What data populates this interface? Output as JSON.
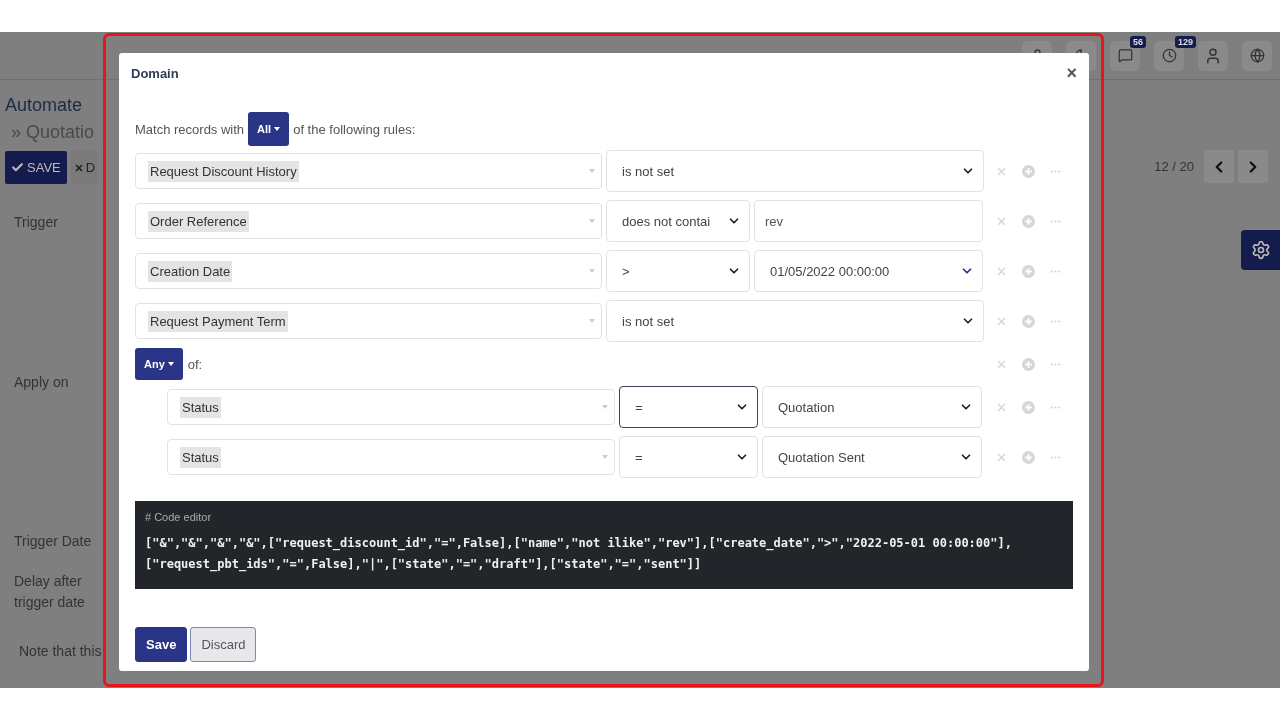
{
  "background": {
    "title": "Automate",
    "breadcrumb": "» Quotatio",
    "save_button": "SAVE",
    "discard_button": "D",
    "topbar_badges": [
      "56",
      "129"
    ],
    "labels": [
      "Trigger",
      "Apply on",
      "Trigger Date",
      "Delay after trigger date",
      "Note that this"
    ],
    "pager": "12 / 20"
  },
  "dialog": {
    "title": "Domain",
    "close": "×",
    "match": {
      "prefix": "Match records with",
      "mode": "All",
      "suffix": "of the following rules:"
    },
    "rules": [
      {
        "kind": "unary",
        "field": "Request Discount History",
        "operator": "is not set",
        "focused": false
      },
      {
        "kind": "input",
        "field": "Order Reference",
        "operator": "does not contai",
        "value": "rev",
        "focused": false
      },
      {
        "kind": "date",
        "field": "Creation Date",
        "operator": ">",
        "value": "01/05/2022 00:00:00",
        "focused": false
      },
      {
        "kind": "unary",
        "field": "Request Payment Term",
        "operator": "is not set",
        "focused": false
      },
      {
        "kind": "group",
        "mode": "Any",
        "suffix": "of:",
        "children": [
          {
            "kind": "select",
            "field": "Status",
            "operator": "=",
            "value": "Quotation",
            "focused": true
          },
          {
            "kind": "select",
            "field": "Status",
            "operator": "=",
            "value": "Quotation Sent",
            "focused": false
          }
        ]
      }
    ],
    "code_editor": {
      "label": "# Code editor",
      "lines": [
        "[\"&\",\"&\",\"&\",\"&\",[\"request_discount_id\",\"=\",False],[\"name\",\"not ilike\",\"rev\"],[\"create_date\",\">\",\"2022-05-01 00:00:00\"],",
        "[\"request_pbt_ids\",\"=\",False],\"|\",[\"state\",\"=\",\"draft\"],[\"state\",\"=\",\"sent\"]]"
      ]
    },
    "buttons": [
      "Save",
      "Discard"
    ]
  }
}
